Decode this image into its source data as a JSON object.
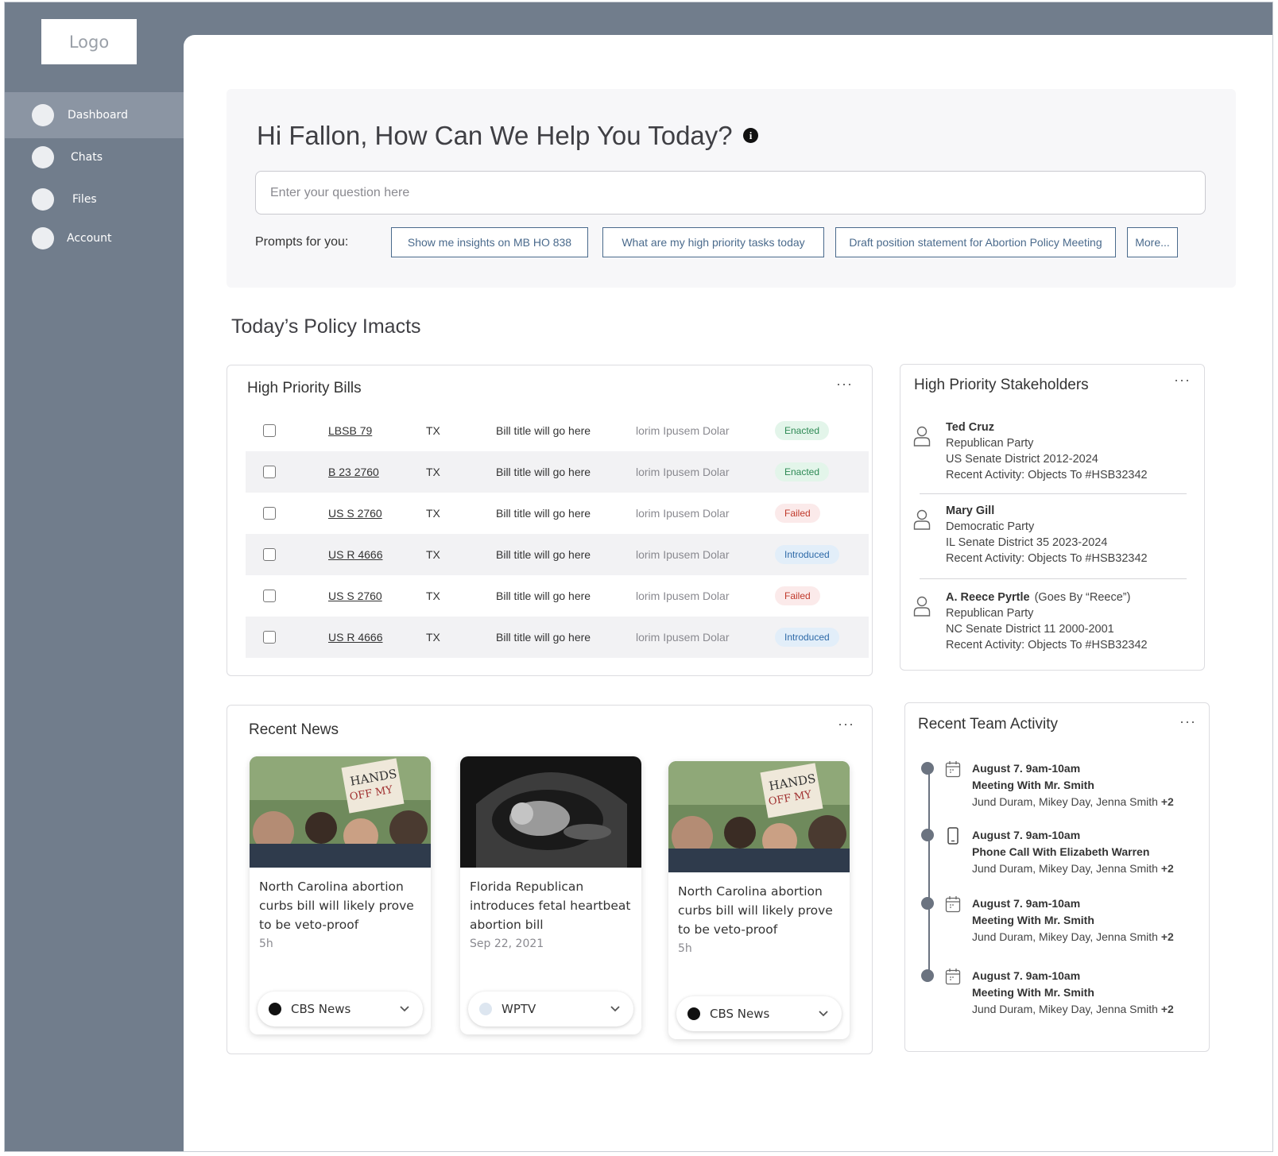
{
  "sidebar": {
    "logo": "Logo",
    "items": [
      {
        "label": "Dashboard"
      },
      {
        "label": "Chats"
      },
      {
        "label": "Files"
      },
      {
        "label": "Account"
      }
    ]
  },
  "hero": {
    "title": "Hi Fallon, How Can We Help You Today?",
    "info_icon": "i",
    "search_placeholder": "Enter your question here",
    "prompts_label": "Prompts for you:",
    "prompts": [
      "Show me insights on MB HO 838",
      "What are my high priority tasks today",
      "Draft position statement for Abortion Policy Meeting",
      "More..."
    ]
  },
  "section_title": "Today’s Policy Imacts",
  "bills": {
    "title": "High Priority Bills",
    "more": "···",
    "rows": [
      {
        "id": "LBSB 79",
        "state": "TX",
        "title": "Bill title will go here",
        "desc": "lorim Ipusem Dolar",
        "status": "Enacted"
      },
      {
        "id": "B 23 2760",
        "state": "TX",
        "title": "Bill title will go here",
        "desc": "lorim Ipusem Dolar",
        "status": "Enacted"
      },
      {
        "id": "US S 2760",
        "state": "TX",
        "title": "Bill title will go here",
        "desc": "lorim Ipusem Dolar",
        "status": "Failed"
      },
      {
        "id": "US R 4666",
        "state": "TX",
        "title": "Bill title will go here",
        "desc": "lorim Ipusem Dolar",
        "status": "Introduced"
      },
      {
        "id": "US S 2760",
        "state": "TX",
        "title": "Bill title will go here",
        "desc": "lorim Ipusem Dolar",
        "status": "Failed"
      },
      {
        "id": "US R 4666",
        "state": "TX",
        "title": "Bill title will go here",
        "desc": "lorim Ipusem Dolar",
        "status": "Introduced"
      }
    ]
  },
  "stakeholders": {
    "title": "High Priority Stakeholders",
    "more": "···",
    "people": [
      {
        "name": "Ted Cruz",
        "alias": "",
        "party": "Republican Party",
        "district": "US Senate District 2012-2024",
        "activity": "Recent Activity:  Objects To #HSB32342"
      },
      {
        "name": "Mary Gill",
        "alias": "",
        "party": "Democratic Party",
        "district": "IL Senate District 35 2023-2024",
        "activity": "Recent Activity:  Objects To #HSB32342"
      },
      {
        "name": "A. Reece Pyrtle",
        "alias": "(Goes By “Reece”)",
        "party": "Republican Party",
        "district": "NC Senate District 11 2000-2001",
        "activity": "Recent Activity: Objects To #HSB32342"
      }
    ]
  },
  "news": {
    "title": "Recent News",
    "more": "···",
    "items": [
      {
        "headline": "North Carolina abortion curbs bill will likely prove to be veto-proof",
        "time": "5h",
        "source": "CBS News"
      },
      {
        "headline": "Florida Republican introduces fetal heartbeat abortion bill",
        "time": "Sep 22, 2021",
        "source": "WPTV"
      },
      {
        "headline": "North Carolina abortion curbs bill will likely prove to be veto-proof",
        "time": "5h",
        "source": "CBS News"
      }
    ]
  },
  "activity": {
    "title": "Recent Team Activity",
    "more": "···",
    "items": [
      {
        "date": "August 7. 9am-10am",
        "name": "Meeting With Mr. Smith",
        "people": "Jund Duram, Mikey Day, Jenna Smith",
        "plus": "+2",
        "icon": "calendar-icon"
      },
      {
        "date": "August 7. 9am-10am",
        "name": "Phone Call With Elizabeth Warren",
        "people": "Jund Duram, Mikey Day, Jenna Smith",
        "plus": "+2",
        "icon": "phone-icon"
      },
      {
        "date": "August 7. 9am-10am",
        "name": "Meeting With Mr. Smith",
        "people": "Jund Duram, Mikey Day, Jenna Smith",
        "plus": "+2",
        "icon": "calendar-icon"
      },
      {
        "date": "August 7. 9am-10am",
        "name": "Meeting With Mr. Smith",
        "people": "Jund Duram, Mikey Day, Jenna Smith",
        "plus": "+2",
        "icon": "calendar-icon"
      }
    ]
  },
  "colors": {
    "sidebar": "#717d8c",
    "sidebar_active": "#8b95a3",
    "accent": "#4a6a8c",
    "enacted": "#2e8a55",
    "failed": "#c0392b",
    "introduced": "#2e6aa8"
  }
}
